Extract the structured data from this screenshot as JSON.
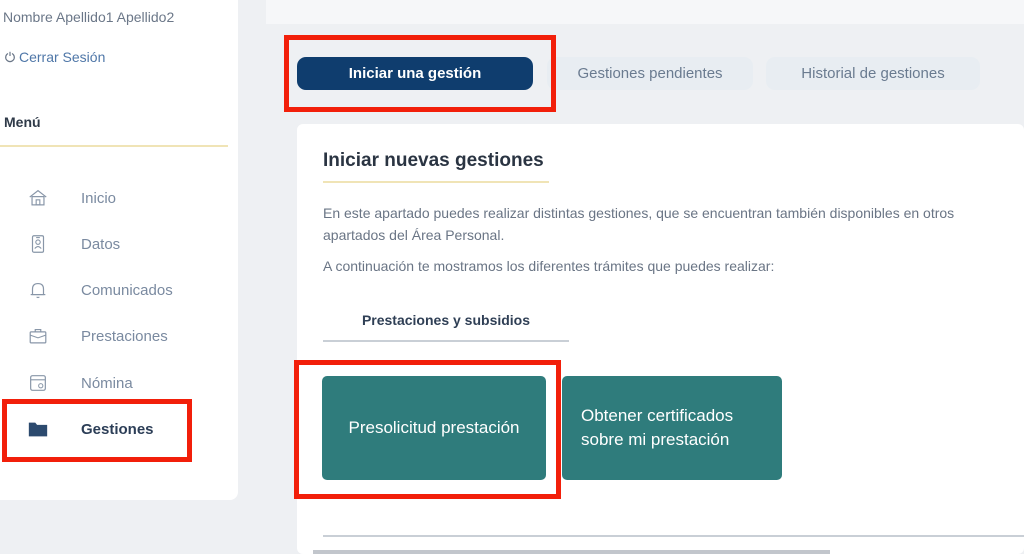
{
  "user": {
    "name": "Nombre Apellido1 Apellido2",
    "logout_label": "Cerrar Sesión"
  },
  "sidebar": {
    "menu_title": "Menú",
    "items": [
      {
        "label": "Inicio",
        "icon": "home-icon"
      },
      {
        "label": "Datos",
        "icon": "id-card-icon"
      },
      {
        "label": "Comunicados",
        "icon": "bell-icon"
      },
      {
        "label": "Prestaciones",
        "icon": "briefcase-icon"
      },
      {
        "label": "Nómina",
        "icon": "payslip-icon"
      },
      {
        "label": "Gestiones",
        "icon": "folder-icon",
        "active": true
      }
    ]
  },
  "tabs": [
    {
      "label": "Iniciar una gestión",
      "active": true
    },
    {
      "label": "Gestiones pendientes",
      "active": false
    },
    {
      "label": "Historial de gestiones",
      "active": false
    }
  ],
  "main": {
    "title": "Iniciar nuevas gestiones",
    "description": "En este apartado puedes realizar distintas gestiones, que se encuentran también disponibles en otros apartados del Área Personal.",
    "intro": "A continuación te mostramos los diferentes trámites que puedes realizar:",
    "subtab": "Prestaciones y subsidios",
    "actions": [
      {
        "label": "Presolicitud prestación"
      },
      {
        "label": "Obtener certificados sobre mi prestación"
      }
    ]
  },
  "colors": {
    "primary": "#0f3d6e",
    "action": "#2f7c7c",
    "highlight": "#f21f0a",
    "accent_line": "#f0e4b6"
  }
}
